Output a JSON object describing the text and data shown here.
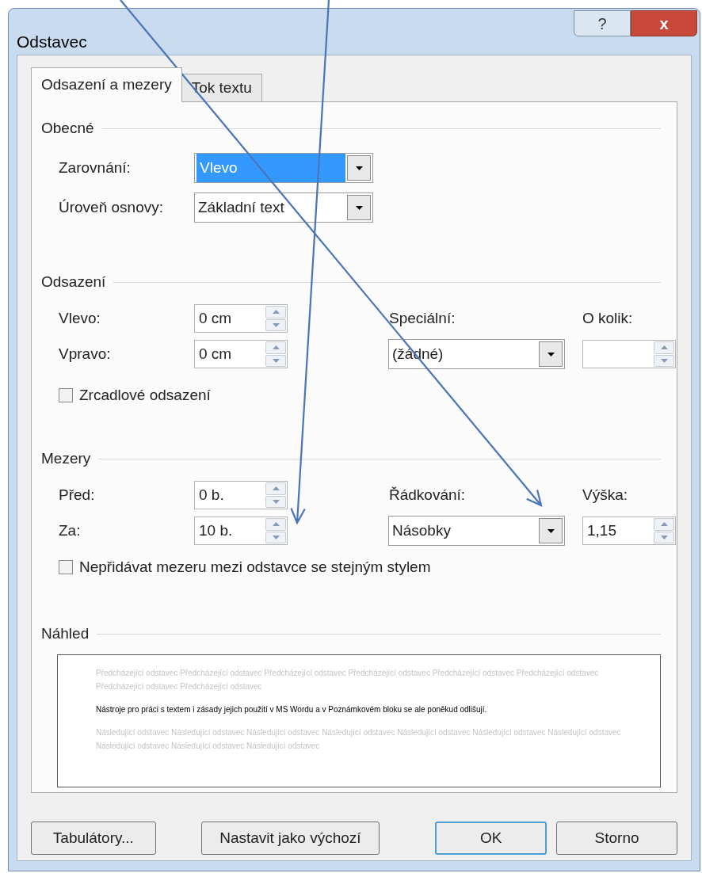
{
  "window": {
    "title": "Odstavec",
    "help_button": "?",
    "close_button": "x"
  },
  "tabs": [
    {
      "label": "Odsazení a mezery",
      "selected": true
    },
    {
      "label": "Tok textu",
      "selected": false
    }
  ],
  "general": {
    "heading": "Obecné",
    "alignment": {
      "label": "Zarovnání:",
      "value": "Vlevo",
      "focused": true
    },
    "outline_level": {
      "label": "Úroveň osnovy:",
      "value": "Základní text",
      "focused": false
    }
  },
  "indentation": {
    "heading": "Odsazení",
    "left": {
      "label": "Vlevo:",
      "value": "0 cm"
    },
    "right": {
      "label": "Vpravo:",
      "value": "0 cm"
    },
    "special": {
      "label": "Speciální:",
      "value": "(žádné)"
    },
    "by": {
      "label": "O kolik:"
    },
    "mirror": {
      "label": "Zrcadlové odsazení",
      "checked": false
    }
  },
  "spacing": {
    "heading": "Mezery",
    "before": {
      "label": "Před:",
      "value": "0 b."
    },
    "after": {
      "label": "Za:",
      "value": "10 b."
    },
    "line_spacing": {
      "label": "Řádkování:",
      "value": "Násobky"
    },
    "at": {
      "label": "Výška:",
      "value": "1,15"
    },
    "dont_add": {
      "label": "Nepřidávat mezeru mezi odstavce se stejným stylem",
      "checked": false
    }
  },
  "preview": {
    "heading": "Náhled",
    "previous": "Předcházející odstavec Předcházející odstavec Předcházející odstavec Předcházející odstavec Předcházející odstavec Předcházející odstavec Předcházející odstavec Předcházející odstavec",
    "current": "Nástroje pro práci s textem i zásady jejich použití v MS Wordu a v Poznámkovém bloku se ale poněkud odlišují.",
    "next": "Následující odstavec Následující odstavec Následující odstavec Následující odstavec Následující odstavec Následující odstavec Následující odstavec Následující odstavec Následující odstavec Následující odstavec"
  },
  "buttons": [
    {
      "label": "Tabulátory...",
      "default": false
    },
    {
      "label": "Nastavit jako výchozí",
      "default": false
    },
    {
      "label": "OK",
      "default": true
    },
    {
      "label": "Storno",
      "default": false
    }
  ],
  "annotation_arrows": [
    {
      "kind": "arrow"
    },
    {
      "kind": "arrow"
    }
  ]
}
